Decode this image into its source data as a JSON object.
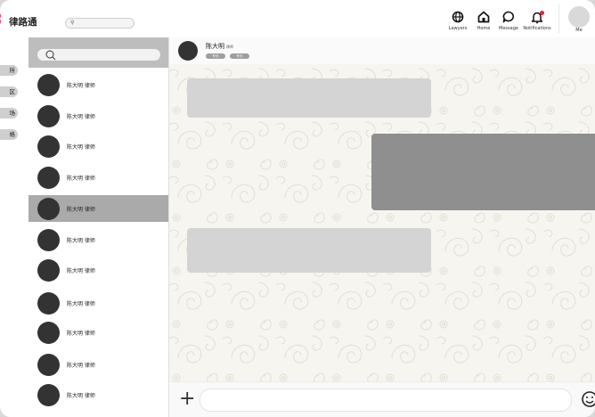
{
  "app": {
    "brand": "律路通",
    "brand_color": "#e0528a"
  },
  "header": {
    "search_placeholder": "",
    "nav": [
      {
        "label": "Lawyers",
        "icon": "globe-icon"
      },
      {
        "label": "Home",
        "icon": "home-icon"
      },
      {
        "label": "Message",
        "icon": "message-icon"
      },
      {
        "label": "Notifications",
        "icon": "bell-icon",
        "badge_color": "#e61e3c"
      }
    ],
    "me_label": "Me"
  },
  "leftnav": {
    "items": [
      "所",
      "区",
      "场",
      "格"
    ]
  },
  "contacts": {
    "search_placeholder": "",
    "items": [
      {
        "name": "陈大明 律师"
      },
      {
        "name": "陈大明 律师"
      },
      {
        "name": "陈大明 律师"
      },
      {
        "name": "陈大明 律师"
      },
      {
        "name": "陈大明 律师",
        "active": true
      },
      {
        "name": "陈大明 律师"
      },
      {
        "name": "陈大明 律师"
      },
      {
        "name": "陈大明 律师"
      },
      {
        "name": "陈大明 律师"
      },
      {
        "name": "陈大明 律师"
      },
      {
        "name": "陈大明 律师"
      }
    ]
  },
  "chat": {
    "contact_name": "陈大明",
    "contact_title": "律师",
    "tags": [
      "专长",
      "专长"
    ],
    "message_placeholder": ""
  }
}
